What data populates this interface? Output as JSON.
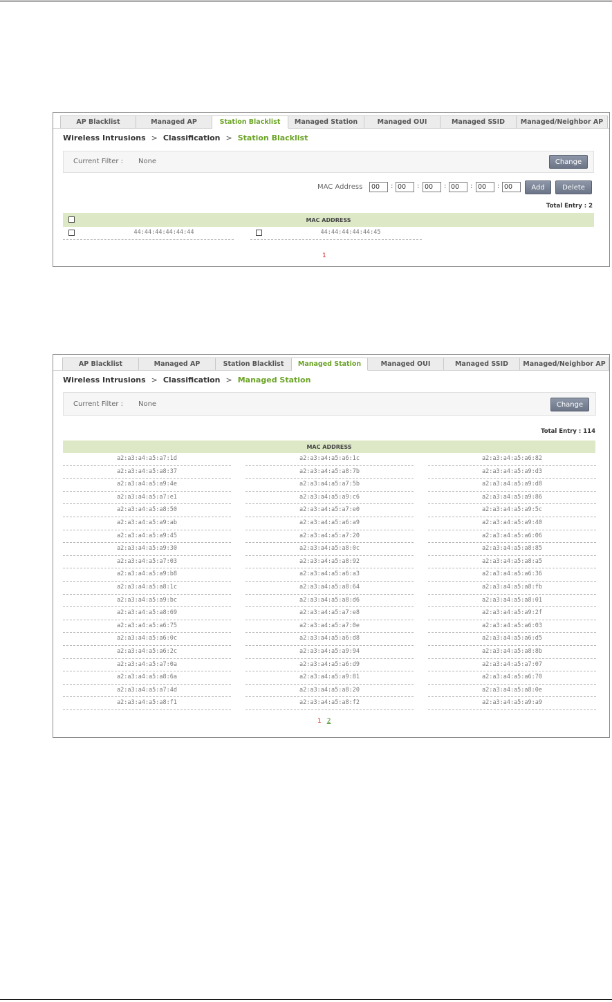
{
  "blacklist_panel": {
    "tabs": [
      {
        "label": "AP Blacklist",
        "active": false
      },
      {
        "label": "Managed AP",
        "active": false
      },
      {
        "label": "Station Blacklist",
        "active": true
      },
      {
        "label": "Managed Station",
        "active": false
      },
      {
        "label": "Managed OUI",
        "active": false
      },
      {
        "label": "Managed SSID",
        "active": false
      },
      {
        "label": "Managed/Neighbor AP",
        "active": false
      }
    ],
    "breadcrumb": {
      "part1": "Wireless Intrusions",
      "sep": ">",
      "part2": "Classification",
      "current": "Station Blacklist"
    },
    "filter": {
      "label": "Current Filter :",
      "value": "None",
      "change_label": "Change"
    },
    "mac_form": {
      "label": "MAC Address",
      "octets": [
        "00",
        "00",
        "00",
        "00",
        "00",
        "00"
      ],
      "separator": ":",
      "add_label": "Add",
      "delete_label": "Delete"
    },
    "total": "Total Entry : 2",
    "table_header": "MAC ADDRESS",
    "entries": [
      "44:44:44:44:44:44",
      "44:44:44:44:44:45"
    ],
    "pager": {
      "current": "1"
    }
  },
  "station_panel": {
    "tabs": [
      {
        "label": "AP Blacklist",
        "active": false
      },
      {
        "label": "Managed AP",
        "active": false
      },
      {
        "label": "Station Blacklist",
        "active": false
      },
      {
        "label": "Managed Station",
        "active": true
      },
      {
        "label": "Managed OUI",
        "active": false
      },
      {
        "label": "Managed SSID",
        "active": false
      },
      {
        "label": "Managed/Neighbor AP",
        "active": false
      }
    ],
    "breadcrumb": {
      "part1": "Wireless Intrusions",
      "sep": ">",
      "part2": "Classification",
      "current": "Managed Station"
    },
    "filter": {
      "label": "Current Filter :",
      "value": "None",
      "change_label": "Change"
    },
    "total": "Total Entry : 114",
    "table_header": "MAC ADDRESS",
    "rows": [
      [
        "a2:a3:a4:a5:a7:1d",
        "a2:a3:a4:a5:a6:1c",
        "a2:a3:a4:a5:a6:82"
      ],
      [
        "a2:a3:a4:a5:a8:37",
        "a2:a3:a4:a5:a8:7b",
        "a2:a3:a4:a5:a9:d3"
      ],
      [
        "a2:a3:a4:a5:a9:4e",
        "a2:a3:a4:a5:a7:5b",
        "a2:a3:a4:a5:a9:d8"
      ],
      [
        "a2:a3:a4:a5:a7:e1",
        "a2:a3:a4:a5:a9:c6",
        "a2:a3:a4:a5:a9:86"
      ],
      [
        "a2:a3:a4:a5:a8:50",
        "a2:a3:a4:a5:a7:e0",
        "a2:a3:a4:a5:a9:5c"
      ],
      [
        "a2:a3:a4:a5:a9:ab",
        "a2:a3:a4:a5:a6:a9",
        "a2:a3:a4:a5:a9:40"
      ],
      [
        "a2:a3:a4:a5:a9:45",
        "a2:a3:a4:a5:a7:20",
        "a2:a3:a4:a5:a6:06"
      ],
      [
        "a2:a3:a4:a5:a9:30",
        "a2:a3:a4:a5:a8:0c",
        "a2:a3:a4:a5:a8:85"
      ],
      [
        "a2:a3:a4:a5:a7:03",
        "a2:a3:a4:a5:a8:92",
        "a2:a3:a4:a5:a8:a5"
      ],
      [
        "a2:a3:a4:a5:a9:b8",
        "a2:a3:a4:a5:a6:a3",
        "a2:a3:a4:a5:a6:36"
      ],
      [
        "a2:a3:a4:a5:a8:1c",
        "a2:a3:a4:a5:a8:64",
        "a2:a3:a4:a5:a8:fb"
      ],
      [
        "a2:a3:a4:a5:a9:bc",
        "a2:a3:a4:a5:a8:d6",
        "a2:a3:a4:a5:a8:01"
      ],
      [
        "a2:a3:a4:a5:a8:69",
        "a2:a3:a4:a5:a7:e8",
        "a2:a3:a4:a5:a9:2f"
      ],
      [
        "a2:a3:a4:a5:a6:75",
        "a2:a3:a4:a5:a7:0e",
        "a2:a3:a4:a5:a6:03"
      ],
      [
        "a2:a3:a4:a5:a6:0c",
        "a2:a3:a4:a5:a6:d8",
        "a2:a3:a4:a5:a6:d5"
      ],
      [
        "a2:a3:a4:a5:a6:2c",
        "a2:a3:a4:a5:a9:94",
        "a2:a3:a4:a5:a8:8b"
      ],
      [
        "a2:a3:a4:a5:a7:0a",
        "a2:a3:a4:a5:a6:d9",
        "a2:a3:a4:a5:a7:07"
      ],
      [
        "a2:a3:a4:a5:a8:6a",
        "a2:a3:a4:a5:a9:81",
        "a2:a3:a4:a5:a6:70"
      ],
      [
        "a2:a3:a4:a5:a7:4d",
        "a2:a3:a4:a5:a8:20",
        "a2:a3:a4:a5:a8:0e"
      ],
      [
        "a2:a3:a4:a5:a8:f1",
        "a2:a3:a4:a5:a8:f2",
        "a2:a3:a4:a5:a9:a9"
      ]
    ],
    "pager": {
      "current": "1",
      "next": "2"
    }
  }
}
